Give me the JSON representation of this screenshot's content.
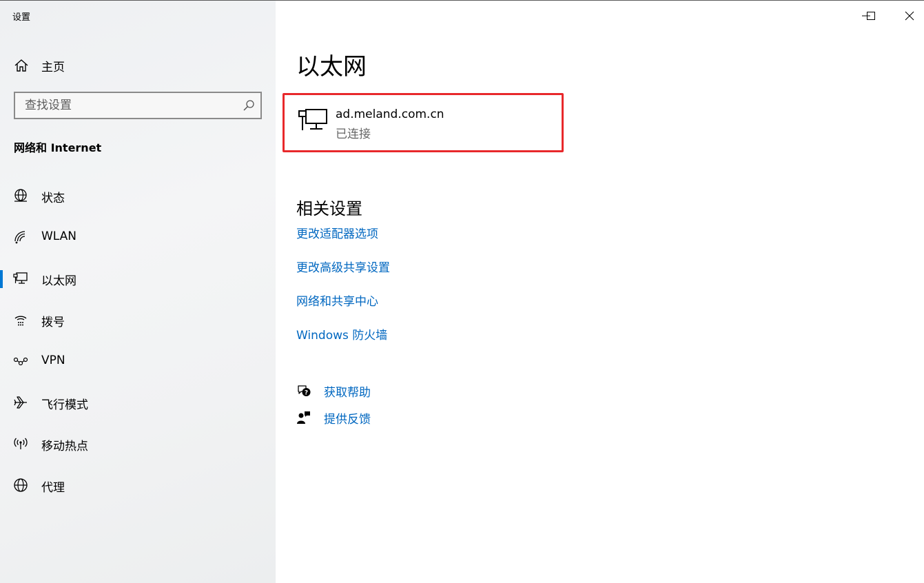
{
  "window": {
    "app_title": "设置",
    "controls": [
      "minimize-icon",
      "maximize-icon",
      "close-icon"
    ]
  },
  "sidebar": {
    "home_label": "主页",
    "search": {
      "placeholder": "查找设置",
      "value": ""
    },
    "section_title": "网络和 Internet",
    "items": [
      {
        "label": "状态",
        "icon": "globe-status-icon",
        "active": false
      },
      {
        "label": "WLAN",
        "icon": "wifi-icon",
        "active": false
      },
      {
        "label": "以太网",
        "icon": "ethernet-icon",
        "active": true
      },
      {
        "label": "拨号",
        "icon": "dialup-icon",
        "active": false
      },
      {
        "label": "VPN",
        "icon": "vpn-icon",
        "active": false
      },
      {
        "label": "飞行模式",
        "icon": "airplane-icon",
        "active": false
      },
      {
        "label": "移动热点",
        "icon": "hotspot-icon",
        "active": false
      },
      {
        "label": "代理",
        "icon": "globe-icon",
        "active": false
      }
    ]
  },
  "main": {
    "title": "以太网",
    "network": {
      "name": "ad.meland.com.cn",
      "status": "已连接",
      "icon": "ethernet-icon"
    },
    "related_title": "相关设置",
    "links": [
      "更改适配器选项",
      "更改高级共享设置",
      "网络和共享中心",
      "Windows 防火墙"
    ],
    "help": [
      {
        "label": "获取帮助",
        "icon": "help-chat-icon"
      },
      {
        "label": "提供反馈",
        "icon": "feedback-icon"
      }
    ]
  },
  "colors": {
    "accent": "#0078d4",
    "link": "#0067c0",
    "highlight_border": "#e8282b"
  }
}
